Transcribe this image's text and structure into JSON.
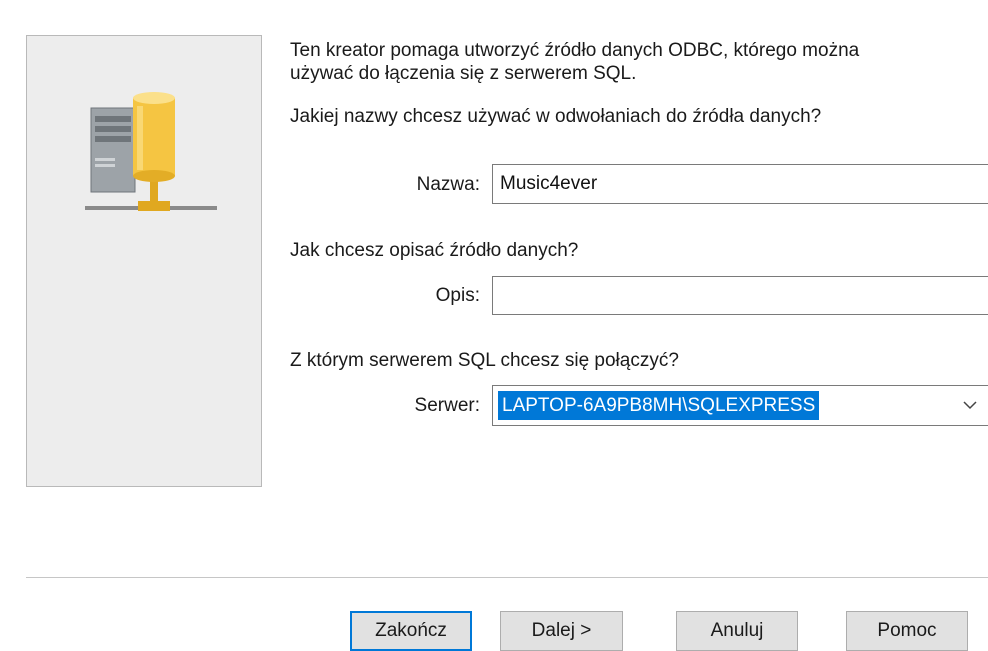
{
  "intro": {
    "line1": "Ten kreator pomaga utworzyć źródło danych ODBC, którego można",
    "line2": "używać do łączenia się z serwerem SQL."
  },
  "questions": {
    "name_question": "Jakiej nazwy chcesz używać w odwołaniach do źródła danych?",
    "description_question": "Jak chcesz opisać źródło danych?",
    "server_question": "Z którym serwerem SQL chcesz się połączyć?"
  },
  "fields": {
    "name": {
      "label": "Nazwa:",
      "value": "Music4ever"
    },
    "description": {
      "label": "Opis:",
      "value": ""
    },
    "server": {
      "label": "Serwer:",
      "value": "LAPTOP-6A9PB8MH\\SQLEXPRESS"
    }
  },
  "buttons": {
    "finish": "Zakończ",
    "next": "Dalej >",
    "cancel": "Anuluj",
    "help": "Pomoc"
  },
  "icons": {
    "server": "server-database-network-icon",
    "dropdown": "chevron-down-icon"
  },
  "colors": {
    "accent": "#0078d7",
    "panel": "#ededed",
    "cylinder": "#f5c542"
  }
}
